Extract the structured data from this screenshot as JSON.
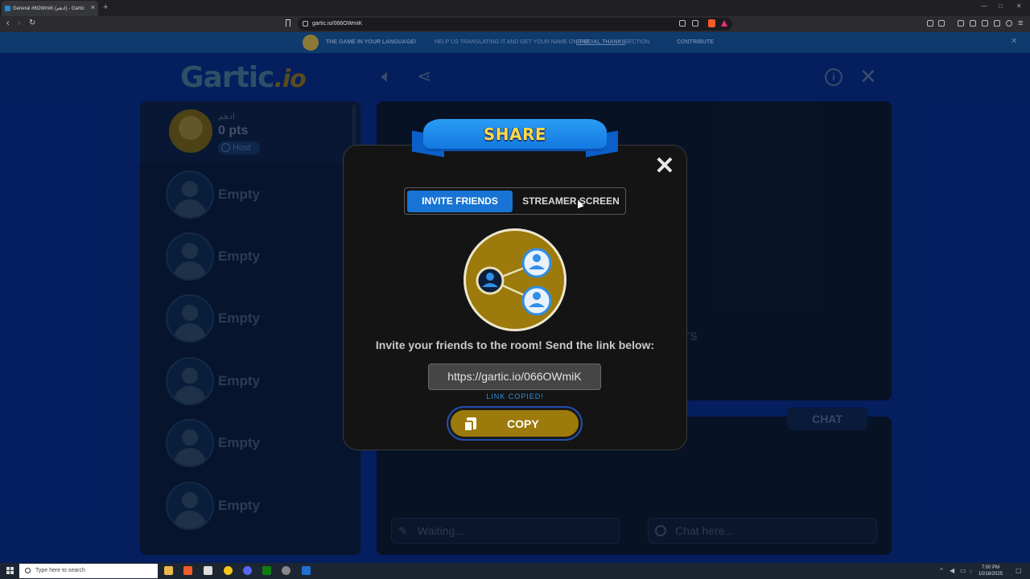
{
  "browser": {
    "tab_title": "General #6OWmiK (ادهم) - Gartic",
    "url": "gartic.io/066OWmiK"
  },
  "banner": {
    "part1": "THE GAME IN YOUR LANGUAGE!",
    "part2": "HELP US TRANSLATING IT AND GET YOUR NAME ON THE",
    "part3": "SPECIAL THANKS",
    "part3b": "SECTION",
    "cta": "CONTRIBUTE"
  },
  "logo": {
    "main": "Gartic",
    "suffix": ".io"
  },
  "players": {
    "host": {
      "name": "ادهم",
      "points": "0 pts",
      "badge": "Host"
    },
    "slots": [
      {
        "label": "Empty"
      },
      {
        "label": "Empty"
      },
      {
        "label": "Empty"
      },
      {
        "label": "Empty"
      },
      {
        "label": "Empty"
      },
      {
        "label": "Empty"
      }
    ]
  },
  "main": {
    "partial_text": "rs"
  },
  "chat": {
    "tab_label": "CHAT",
    "answer_placeholder": "Waiting...",
    "chat_placeholder": "Chat here..."
  },
  "modal": {
    "title": "SHARE",
    "tab_invite": "INVITE FRIENDS",
    "tab_streamer": "STREAMER SCREEN",
    "invite_text": "Invite your friends to the room! Send the link below:",
    "link": "https://gartic.io/066OWmiK",
    "copied": "LINK COPIED!",
    "copy_label": "COPY"
  },
  "taskbar": {
    "search_placeholder": "Type here to search",
    "time": "7:00 PM",
    "date": "10/18/2025"
  },
  "colors": {
    "accent_blue": "#1774d4",
    "gold": "#9c7a0c",
    "title_yellow": "#ffd94a",
    "background": "#072a83"
  }
}
